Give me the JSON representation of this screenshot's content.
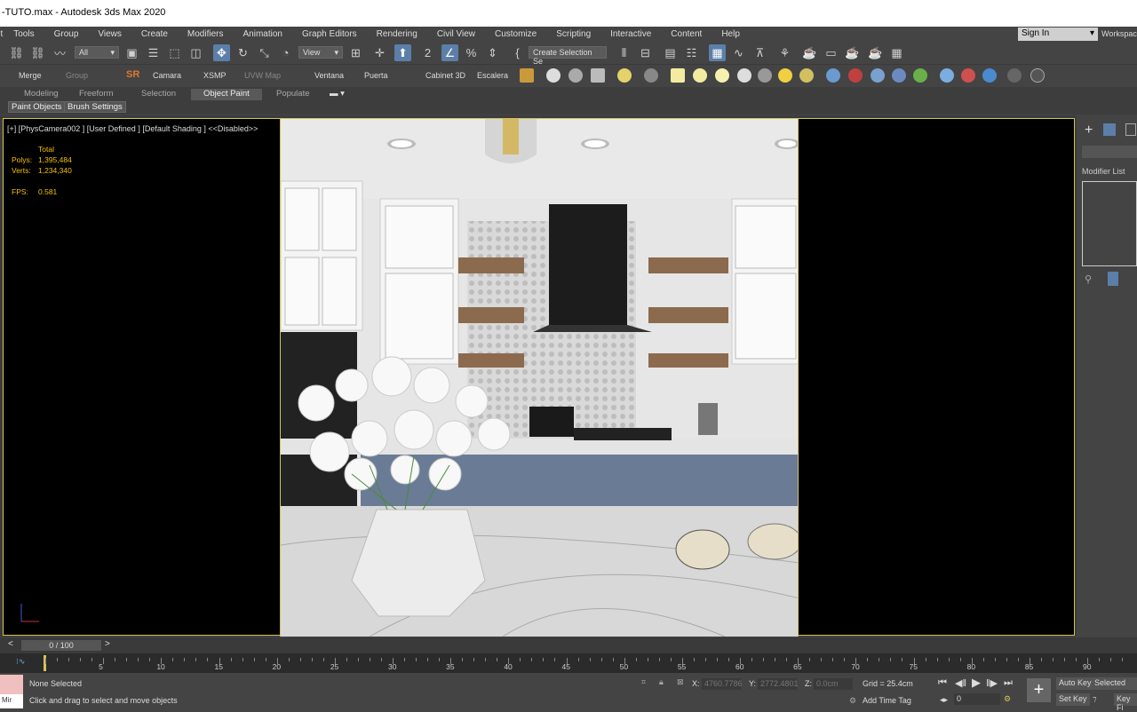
{
  "window": {
    "title": "-TUTO.max - Autodesk 3ds Max 2020"
  },
  "menu": [
    "Edit",
    "Tools",
    "Group",
    "Views",
    "Create",
    "Modifiers",
    "Animation",
    "Graph Editors",
    "Rendering",
    "Civil View",
    "Customize",
    "Scripting",
    "Interactive",
    "Content",
    "Help"
  ],
  "account": {
    "signin": "Sign In",
    "workspace": "Workspac"
  },
  "toolbar": {
    "filter": "All",
    "refcoord": "View",
    "selset": "Create Selection Se"
  },
  "toolbar2": {
    "merge": "Merge",
    "group": "Group",
    "sr": "SR",
    "camara": "Camara",
    "xsmp": "XSMP",
    "uvw": "UVW Map",
    "ventana": "Ventana",
    "puerta": "Puerta",
    "cabinet": "Cabinet 3D",
    "escalera": "Escalera"
  },
  "ribbon": {
    "modeling": "Modeling",
    "freeform": "Freeform",
    "selection": "Selection",
    "objectpaint": "Object Paint",
    "populate": "Populate"
  },
  "ribbon2": {
    "paint_objects": "Paint Objects",
    "brush_settings": "Brush Settings"
  },
  "viewport": {
    "label": "[+] [PhysCamera002 ] [User Defined ] [Default Shading ]  <<Disabled>>",
    "stats": {
      "total": "Total",
      "polys_label": "Polys:",
      "polys": "1,395,484",
      "verts_label": "Verts:",
      "verts": "1,234,340",
      "fps_label": "FPS:",
      "fps": "0.581"
    }
  },
  "command_panel": {
    "modifier_list": "Modifier List"
  },
  "timeline": {
    "frame": "0 / 100",
    "ticks": [
      "0",
      "5",
      "10",
      "15",
      "20",
      "25",
      "30",
      "35",
      "40",
      "45",
      "50",
      "55",
      "60",
      "65",
      "70",
      "75",
      "80",
      "85",
      "90"
    ],
    "current": 0
  },
  "status": {
    "maxscript": "Mir",
    "selection": "None Selected",
    "prompt": "Click and drag to select and move objects",
    "x_label": "X:",
    "x": "4760.7786",
    "y_label": "Y:",
    "y": "2772.4801",
    "z_label": "Z:",
    "z": "0.0cm",
    "grid": "Grid = 25.4cm",
    "add_time_tag": "Add Time Tag",
    "auto_key": "Auto Key",
    "set_key": "Set Key",
    "selected": "Selected",
    "key_filters": "Key Fi",
    "frame_field": "0"
  },
  "colors": {
    "active_tool": "#5b7fa8",
    "viewport_border": "#d6c35a",
    "stats_text": "#f2c200",
    "cabinet_blue": "#6a7b96"
  }
}
